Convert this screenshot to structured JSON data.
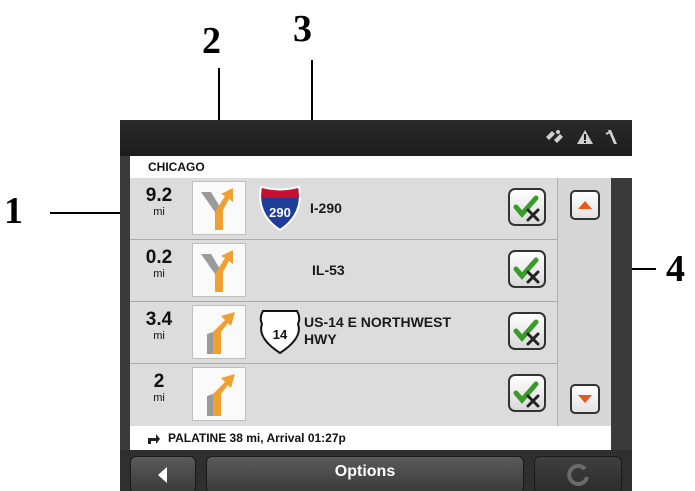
{
  "callouts": [
    "1",
    "2",
    "3",
    "4"
  ],
  "header": {
    "location": "CHICAGO"
  },
  "status_icons": [
    "gps-signal-icon",
    "warning-icon",
    "antenna-icon"
  ],
  "route": [
    {
      "distance": "9.2",
      "unit": "mi",
      "road_line1": "I-290",
      "road_line2": "",
      "shield": "interstate",
      "shield_number": "290",
      "maneuver": "keep-right"
    },
    {
      "distance": "0.2",
      "unit": "mi",
      "road_line1": "IL-53",
      "road_line2": "",
      "shield": "none",
      "shield_number": "",
      "maneuver": "keep-right"
    },
    {
      "distance": "3.4",
      "unit": "mi",
      "road_line1": "US-14 E NORTHWEST",
      "road_line2": "HWY",
      "shield": "us-route",
      "shield_number": "14",
      "maneuver": "bear-right"
    },
    {
      "distance": "2",
      "unit": "mi",
      "road_line1": "",
      "road_line2": "",
      "shield": "none",
      "shield_number": "",
      "maneuver": "bear-right"
    }
  ],
  "destination": {
    "text": "PALATINE 38 mi, Arrival 01:27p"
  },
  "bottom_bar": {
    "options_label": "Options"
  },
  "colors": {
    "turn_arrow": "#f0a030",
    "shield_red": "#c8102e",
    "shield_blue": "#1f3d99",
    "check_green": "#3a9a2a"
  }
}
